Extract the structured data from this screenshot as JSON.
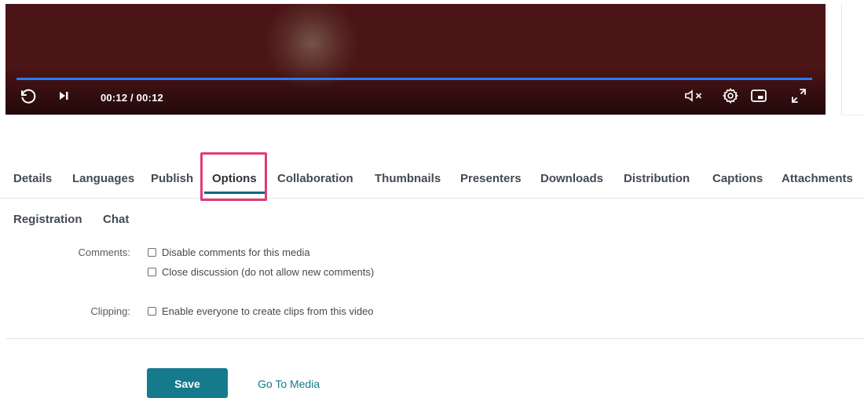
{
  "player": {
    "time_display": "00:12 / 00:12",
    "progress_fraction": 1.0,
    "icons": [
      "replay-icon",
      "next-icon",
      "mute-icon",
      "settings-icon",
      "pip-icon",
      "fullscreen-icon"
    ],
    "colors": {
      "background": "#4b1416",
      "progress": "#2a7bff"
    }
  },
  "tabs_row1": [
    {
      "id": "details",
      "label": "Details"
    },
    {
      "id": "languages",
      "label": "Languages"
    },
    {
      "id": "publish",
      "label": "Publish"
    },
    {
      "id": "options",
      "label": "Options",
      "active": true
    },
    {
      "id": "collaboration",
      "label": "Collaboration"
    },
    {
      "id": "thumbnails",
      "label": "Thumbnails"
    },
    {
      "id": "presenters",
      "label": "Presenters"
    },
    {
      "id": "downloads",
      "label": "Downloads"
    },
    {
      "id": "distribution",
      "label": "Distribution"
    },
    {
      "id": "captions",
      "label": "Captions"
    },
    {
      "id": "attachments",
      "label": "Attachments"
    }
  ],
  "tabs_row2": [
    {
      "id": "registration",
      "label": "Registration"
    },
    {
      "id": "chat",
      "label": "Chat"
    }
  ],
  "form": {
    "comments_label": "Comments:",
    "comments_options": [
      {
        "label": "Disable comments for this media",
        "checked": false
      },
      {
        "label": "Close discussion (do not allow new comments)",
        "checked": false
      }
    ],
    "clipping_label": "Clipping:",
    "clipping_options": [
      {
        "label": "Enable everyone to create clips from this video",
        "checked": false
      }
    ]
  },
  "actions": {
    "save_label": "Save",
    "go_to_media_label": "Go To Media"
  },
  "colors": {
    "accent": "#157a8c",
    "active_tab_underline": "#006a80",
    "highlight": "#e13a78"
  }
}
